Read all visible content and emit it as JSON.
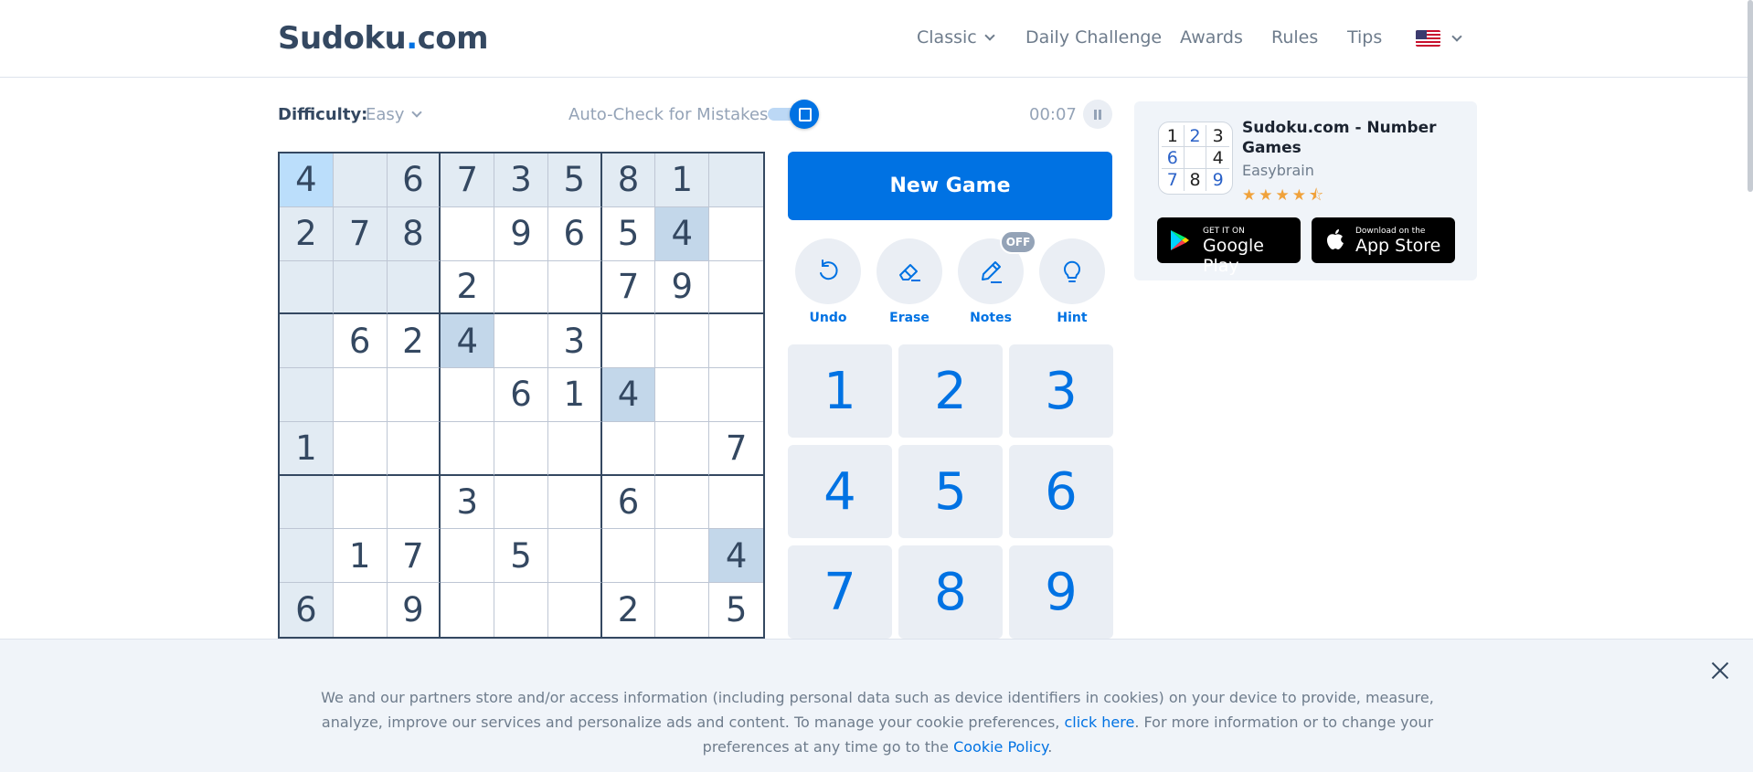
{
  "header": {
    "logo_main": "Sudoku",
    "logo_dot": ".",
    "logo_tld": "com",
    "nav": [
      "Classic",
      "Daily Challenge",
      "Awards",
      "Rules",
      "Tips"
    ],
    "language_icon": "us-flag-icon"
  },
  "controls": {
    "difficulty_label": "Difficulty:",
    "difficulty_value": "Easy",
    "autocheck_label": "Auto-Check for Mistakes",
    "autocheck_on": true,
    "timer": "00:07"
  },
  "board": {
    "grid": [
      [
        "4",
        "",
        "6",
        "7",
        "3",
        "5",
        "8",
        "1",
        ""
      ],
      [
        "2",
        "7",
        "8",
        "",
        "9",
        "6",
        "5",
        "4",
        ""
      ],
      [
        "",
        "",
        "",
        "2",
        "",
        "",
        "7",
        "9",
        ""
      ],
      [
        "",
        "6",
        "2",
        "4",
        "",
        "3",
        "",
        "",
        ""
      ],
      [
        "",
        "",
        "",
        "",
        "6",
        "1",
        "4",
        "",
        ""
      ],
      [
        "1",
        "",
        "",
        "",
        "",
        "",
        "",
        "",
        "7"
      ],
      [
        "",
        "",
        "",
        "3",
        "",
        "",
        "6",
        "",
        ""
      ],
      [
        "",
        "1",
        "7",
        "",
        "5",
        "",
        "",
        "",
        "4"
      ],
      [
        "6",
        "",
        "9",
        "",
        "",
        "",
        "2",
        "",
        "5"
      ]
    ],
    "selected": [
      0,
      0
    ],
    "highlight_color": "#e2ebf3",
    "same_number_color": "#c3d7ea",
    "selected_color": "#bbdefb"
  },
  "actions": {
    "new_game": "New Game",
    "tools": [
      {
        "label": "Undo",
        "icon": "undo-icon"
      },
      {
        "label": "Erase",
        "icon": "eraser-icon"
      },
      {
        "label": "Notes",
        "icon": "pencil-icon"
      },
      {
        "label": "Hint",
        "icon": "lightbulb-icon"
      }
    ],
    "notes_badge": "OFF"
  },
  "numpad": [
    "1",
    "2",
    "3",
    "4",
    "5",
    "6",
    "7",
    "8",
    "9"
  ],
  "ad": {
    "icon_digits": [
      "1",
      "2",
      "3",
      "6",
      "",
      "4",
      "7",
      "8",
      "9"
    ],
    "title": "Sudoku.com - Number Games",
    "developer": "Easybrain",
    "stars": "★★★★⯪",
    "rating": 4.5,
    "google_play_small": "GET IT ON",
    "google_play_big": "Google Play",
    "app_store_small": "Download on the",
    "app_store_big": "App Store"
  },
  "cookie": {
    "text_1": "We and our partners store and/or access information (including personal data such as device identifiers in cookies) on your device to provide, measure, analyze, improve our services and personalize ads and content. To manage your cookie preferences, ",
    "link_1": "click here",
    "text_2": ". For more information or to change your preferences at any time go to the ",
    "link_2": "Cookie Policy",
    "text_3": "."
  },
  "colors": {
    "accent": "#0072e3",
    "text": "#344861",
    "muted": "#94a3b7"
  }
}
